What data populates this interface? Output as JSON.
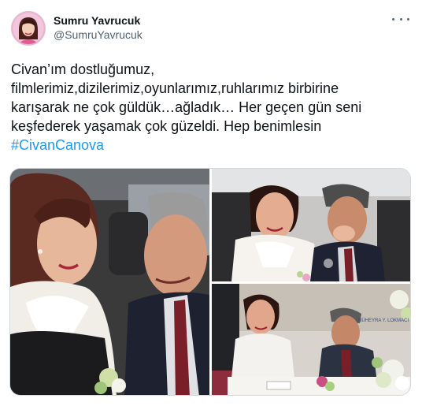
{
  "author": {
    "display_name": "Sumru Yavrucuk",
    "handle": "@SumruYavrucuk",
    "avatar_icon": "profile-avatar"
  },
  "more_icon": "more-options-icon",
  "tweet": {
    "lines": [
      "Civan’ım dostluğumuz,",
      "filmlerimiz,dizilerimiz,oyunlarımız,ruhlarımız birbirine",
      "karışarak ne çok güldük…ağladık… Her geçen gün seni",
      "keşfederek yaşamak çok güzeldi. Hep benimlesin"
    ],
    "hashtag": "#CivanCanova"
  },
  "media": {
    "photo3_sign_text": "NÜHEYRA Y. LOKMACI",
    "colors": {
      "hashtag": "#1d9bf0",
      "text": "#0f1419",
      "secondary": "#536471"
    }
  }
}
